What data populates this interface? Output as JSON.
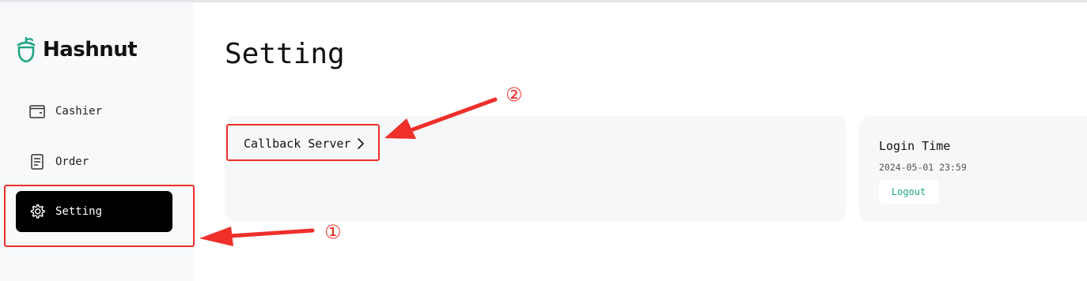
{
  "app": {
    "name": "Hashnut",
    "brand_color": "#1ea684"
  },
  "sidebar": {
    "items": [
      {
        "label": "Cashier",
        "icon": "wallet-icon",
        "active": false
      },
      {
        "label": "Order",
        "icon": "document-icon",
        "active": false
      },
      {
        "label": "Setting",
        "icon": "gear-icon",
        "active": true
      }
    ]
  },
  "main": {
    "title": "Setting",
    "callback": {
      "label": "Callback Server",
      "icon": "chevron-right-icon"
    },
    "login": {
      "title": "Login Time",
      "time": "2024-05-01 23:59",
      "logout_label": "Logout"
    }
  },
  "annotations": {
    "color": "#ee2f2a",
    "markers": [
      "①",
      "②"
    ]
  }
}
